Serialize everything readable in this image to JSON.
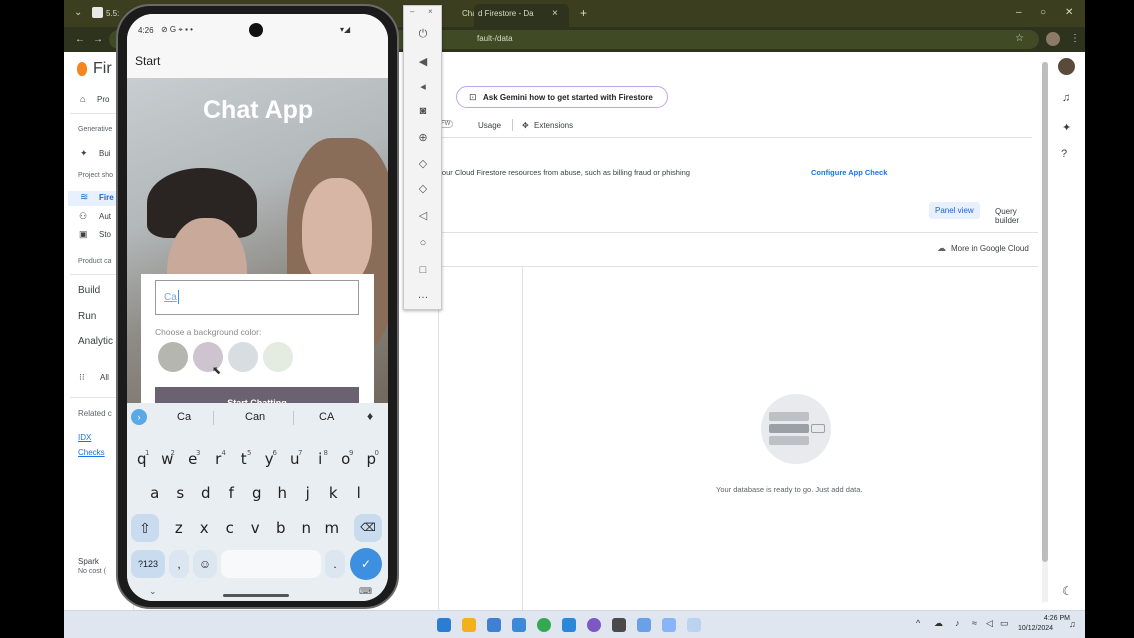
{
  "browser": {
    "tab_left_title": "5.5:",
    "tab_right_prefix": "Cha",
    "active_tab_title": "d Firestore - Da",
    "new_tab": "+",
    "address_fragment": "fault-/data",
    "tab_close": "×"
  },
  "console": {
    "brand_prefix": "Fir",
    "nav": [
      {
        "label": "Pro",
        "icon": "home-icon"
      },
      {
        "label": "Generative",
        "small": true
      },
      {
        "label": "Bui",
        "icon": "sparkle-icon"
      },
      {
        "label": "Project sho",
        "small": true
      },
      {
        "label": "Fire",
        "icon": "firestore-icon"
      },
      {
        "label": "Aut",
        "icon": "users-icon"
      },
      {
        "label": "Sto",
        "icon": "image-icon"
      },
      {
        "label": "Product ca",
        "small": true
      },
      {
        "label": "Build"
      },
      {
        "label": "Run"
      },
      {
        "label": "Analytic"
      },
      {
        "label": "All",
        "icon": "grid-icon"
      },
      {
        "label": "Related c",
        "small": true
      },
      {
        "label": "IDX",
        "link": true
      },
      {
        "label": "Checks",
        "link": true
      }
    ],
    "plan_name": "Spark",
    "plan_sub": "No cost (",
    "gemini_label": "Ask Gemini how to get started with Firestore",
    "tabs": [
      "FW",
      "Usage",
      "Extensions"
    ],
    "banner_text": "t your Cloud Firestore resources from abuse, such as billing fraud or phishing",
    "banner_action": "Configure App Check",
    "panel_view": "Panel view",
    "query_builder": "Query builder",
    "more_cloud": "More in Google Cloud",
    "empty_message": "Your database is ready to go. Just add data."
  },
  "emulator": {
    "tools": [
      "power-icon",
      "volume-up-icon",
      "volume-down-icon",
      "camera-icon",
      "zoom-icon",
      "rotate-left-icon",
      "rotate-right-icon",
      "back-icon",
      "home-icon",
      "overview-icon",
      "more-icon"
    ]
  },
  "phone": {
    "status_time": "4:26",
    "status_icons": "⊘ G ⌖ ▪ •",
    "app_bar_title": "Start",
    "hero_title": "Chat App",
    "name_input_value": "Ca",
    "color_prompt": "Choose a background color:",
    "swatches": [
      "#b6b6b1",
      "#cdc4cf",
      "#d8dde2",
      "#e4ebe0"
    ],
    "start_button": "Start Chatting",
    "suggestions": [
      "Ca",
      "Can",
      "CA"
    ],
    "row1": [
      "q",
      "w",
      "e",
      "r",
      "t",
      "y",
      "u",
      "i",
      "o",
      "p"
    ],
    "row1_digits": [
      "1",
      "2",
      "3",
      "4",
      "5",
      "6",
      "7",
      "8",
      "9",
      "0"
    ],
    "row2": [
      "a",
      "s",
      "d",
      "f",
      "g",
      "h",
      "j",
      "k",
      "l"
    ],
    "row3": [
      "z",
      "x",
      "c",
      "v",
      "b",
      "n",
      "m"
    ],
    "numbers_key": "?123",
    "comma_key": ",",
    "period_key": "."
  },
  "taskbar": {
    "time": "4:26 PM",
    "date": "10/12/2024"
  },
  "colors": {
    "accent": "#1a73e8",
    "start_button": "#6b6170",
    "keyboard_bg": "#e9eef3",
    "enter_key": "#3d8fe0"
  }
}
